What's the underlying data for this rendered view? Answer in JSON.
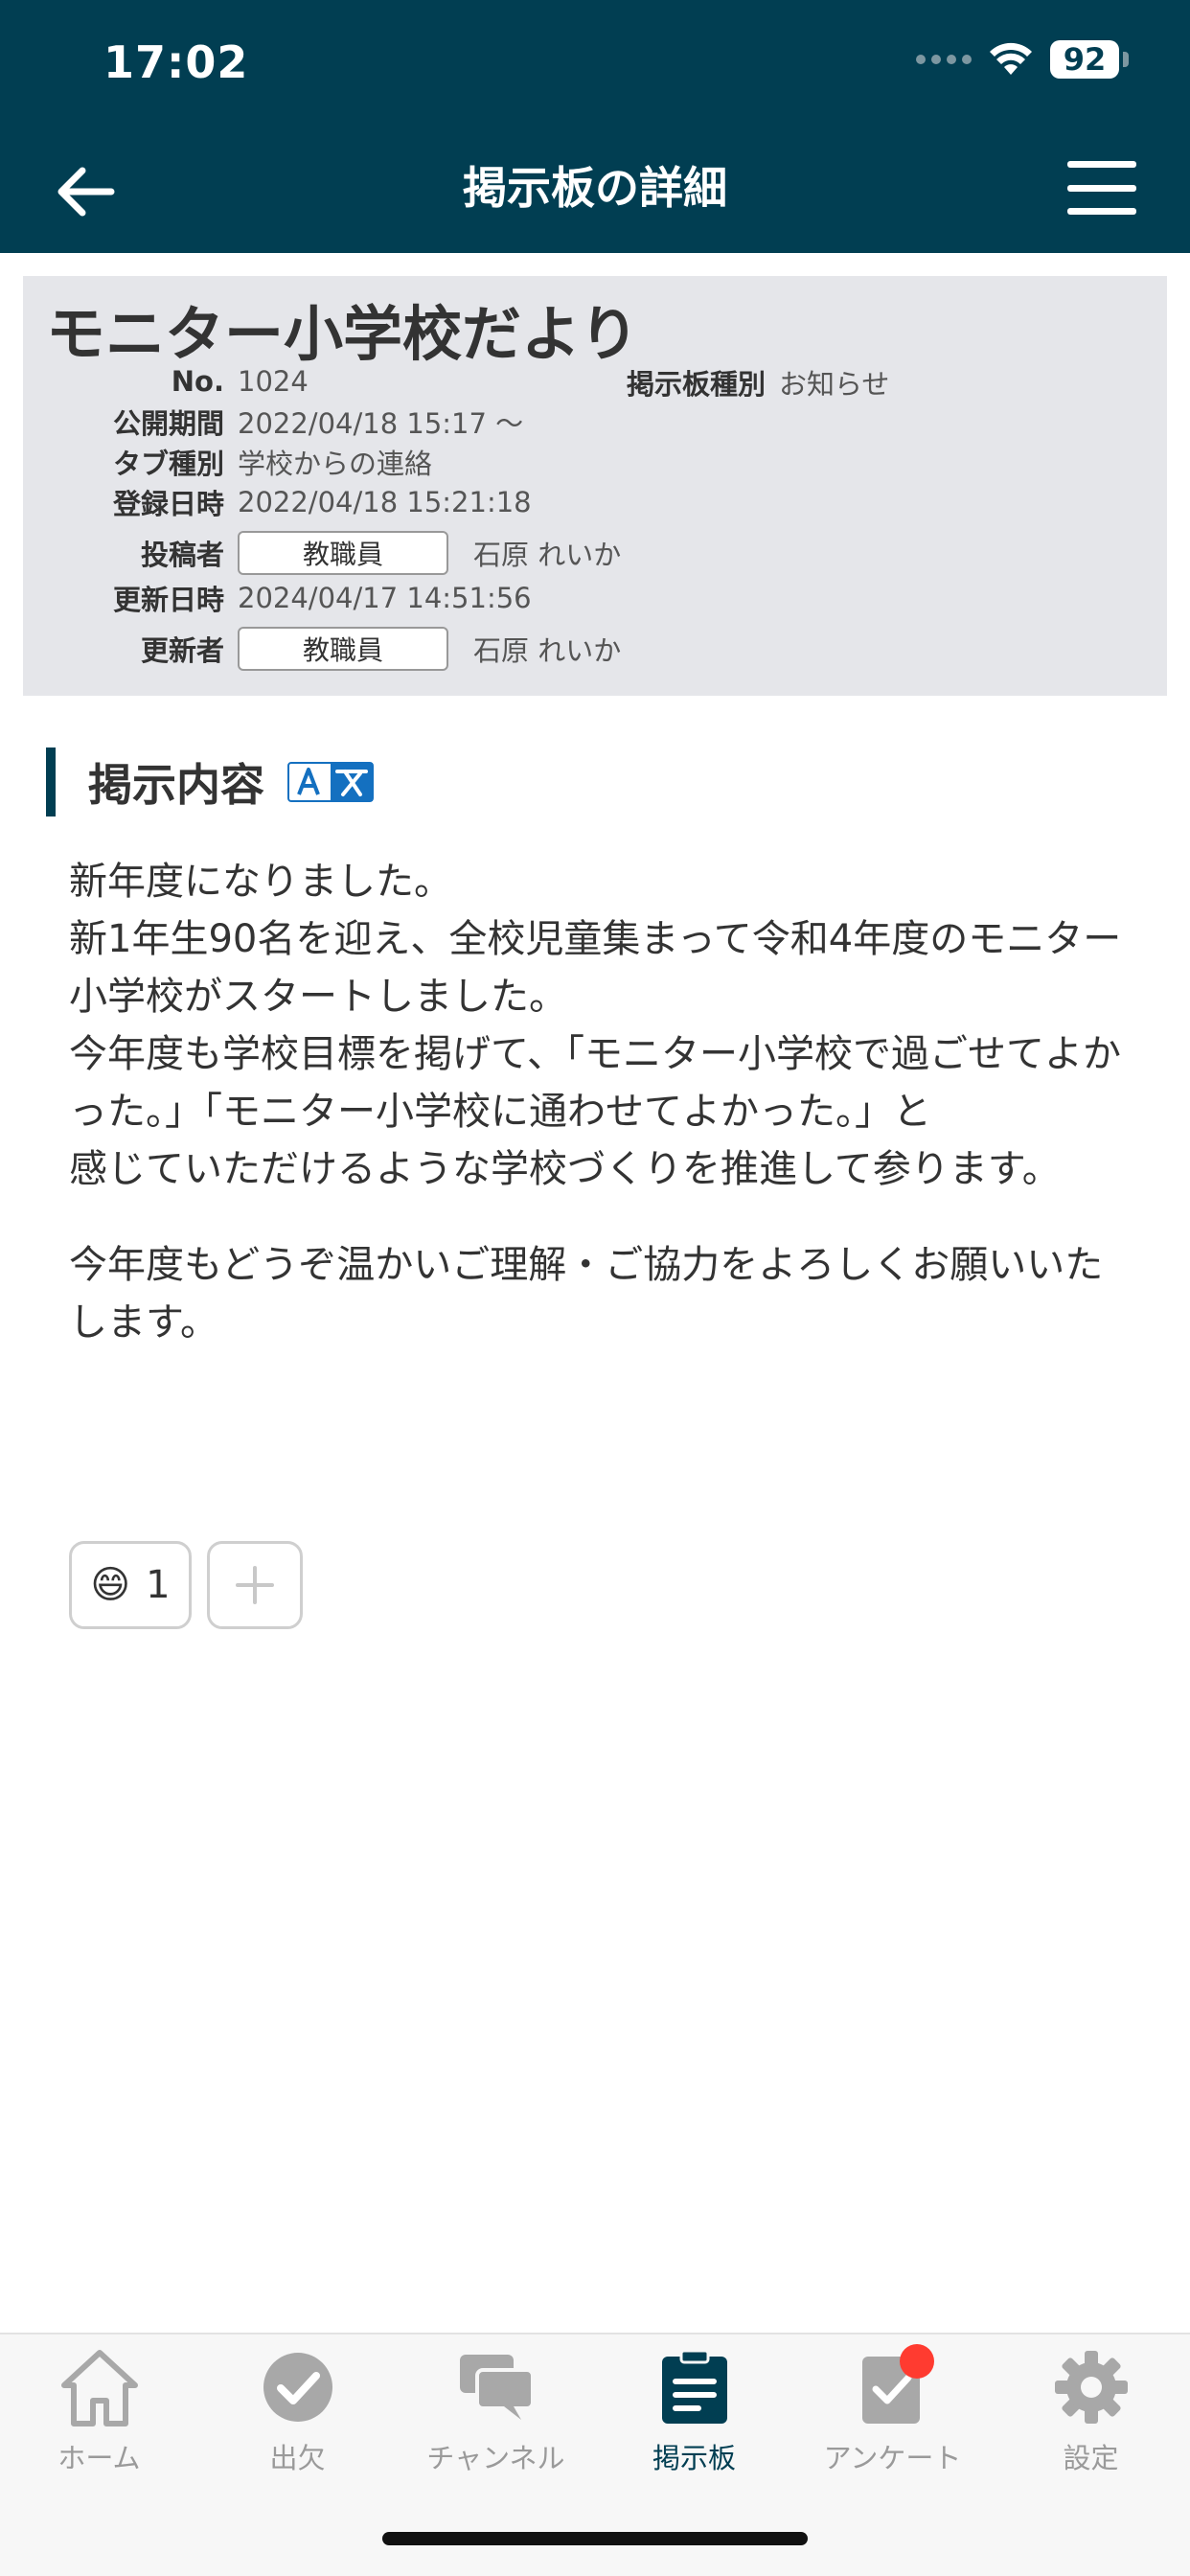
{
  "status_bar": {
    "time": "17:02",
    "battery": "92"
  },
  "nav": {
    "title": "掲示板の詳細"
  },
  "post": {
    "title": "モニター小学校だより",
    "no_label": "No.",
    "no_value": "1024",
    "board_type_label": "掲示板種別",
    "board_type_value": "お知らせ",
    "period_label": "公開期間",
    "period_value": "2022/04/18 15:17 〜",
    "tab_type_label": "タブ種別",
    "tab_type_value": "学校からの連絡",
    "registered_label": "登録日時",
    "registered_value": "2022/04/18 15:21:18",
    "poster_label": "投稿者",
    "poster_role": "教職員",
    "poster_name": "石原 れいか",
    "updated_label": "更新日時",
    "updated_value": "2024/04/17 14:51:56",
    "updater_label": "更新者",
    "updater_role": "教職員",
    "updater_name": "石原 れいか"
  },
  "content": {
    "heading": "掲示内容",
    "paragraph1": "新年度になりました。\n新1年生90名を迎え、全校児童集まって令和4年度のモニター小学校がスタートしました。\n今年度も学校目標を掲げて、「モニター小学校で過ごせてよかった。」「モニター小学校に通わせてよかった。」と\n感じていただけるような学校づくりを推進して参ります。",
    "paragraph2": "今年度もどうぞ温かいご理解・ご協力をよろしくお願いいたします。"
  },
  "reactions": [
    {
      "emoji": "😄",
      "count": "1"
    }
  ],
  "tabs": [
    {
      "label": "ホーム",
      "icon": "home-icon",
      "active": false
    },
    {
      "label": "出欠",
      "icon": "check-circle-icon",
      "active": false
    },
    {
      "label": "チャンネル",
      "icon": "chat-bubbles-icon",
      "active": false
    },
    {
      "label": "掲示板",
      "icon": "clipboard-icon",
      "active": true
    },
    {
      "label": "アンケート",
      "icon": "survey-icon",
      "active": false,
      "badge": true
    },
    {
      "label": "設定",
      "icon": "gear-icon",
      "active": false
    }
  ],
  "colors": {
    "header": "#013e52",
    "accent": "#013e52",
    "tab_inactive": "#9a9a9a",
    "badge": "#ff3b30",
    "card_bg": "#e5e6ea"
  }
}
